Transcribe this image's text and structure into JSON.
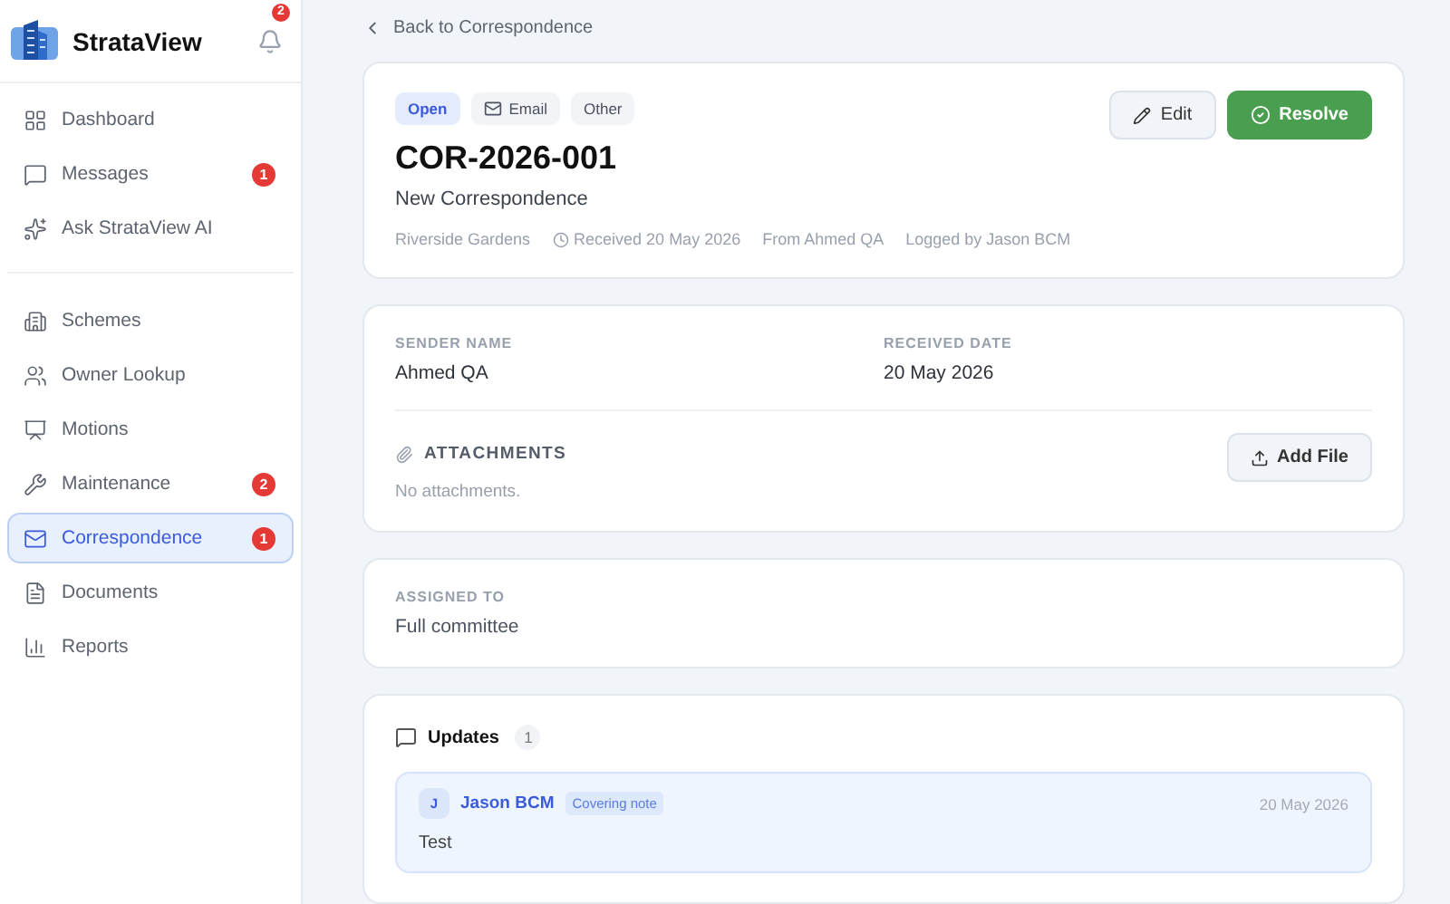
{
  "sidebar": {
    "brand": "StrataView",
    "notifications": "2",
    "groups": [
      [
        {
          "label": "Dashboard",
          "selected": false
        },
        {
          "label": "Messages",
          "selected": false,
          "badge": "1"
        },
        {
          "label": "Ask StrataView AI",
          "selected": false
        }
      ],
      [
        {
          "label": "Schemes",
          "selected": false
        },
        {
          "label": "Owner Lookup",
          "selected": false
        },
        {
          "label": "Motions",
          "selected": false
        },
        {
          "label": "Maintenance",
          "selected": false,
          "badge": "2"
        },
        {
          "label": "Correspondence",
          "selected": true,
          "badge": "1"
        },
        {
          "label": "Documents",
          "selected": false
        },
        {
          "label": "Reports",
          "selected": false
        }
      ]
    ]
  },
  "back_link": "Back to Correspondence",
  "header": {
    "tags": [
      {
        "label": "Open",
        "kind": "status"
      },
      {
        "label": "Email",
        "kind": "channel"
      },
      {
        "label": "Other",
        "kind": "plain"
      }
    ],
    "title": "COR-2026-001",
    "subtitle": "New Correspondence",
    "meta": [
      {
        "text": "Riverside Gardens",
        "kind": "plain"
      },
      {
        "text": "Received 20 May 2026",
        "kind": "clock"
      },
      {
        "text": "From Ahmed QA",
        "kind": "plain"
      },
      {
        "text": "Logged by Jason BCM",
        "kind": "plain"
      }
    ],
    "buttons": [
      {
        "label": "Edit",
        "kind": "secondary"
      },
      {
        "label": "Resolve",
        "kind": "primary"
      }
    ]
  },
  "details": {
    "fields": [
      {
        "label": "SENDER NAME",
        "value": "Ahmed QA"
      },
      {
        "label": "RECEIVED DATE",
        "value": "20 May 2026"
      }
    ],
    "attachments": {
      "title": "ATTACHMENTS",
      "button": "Add File",
      "empty": "No attachments."
    }
  },
  "assigned": {
    "label": "ASSIGNED TO",
    "value": "Full committee"
  },
  "updates": {
    "title": "Updates",
    "count": "1",
    "items": [
      {
        "initial": "J",
        "author": "Jason BCM",
        "tag": "Covering note",
        "date": "20 May 2026",
        "text": "Test"
      }
    ]
  }
}
